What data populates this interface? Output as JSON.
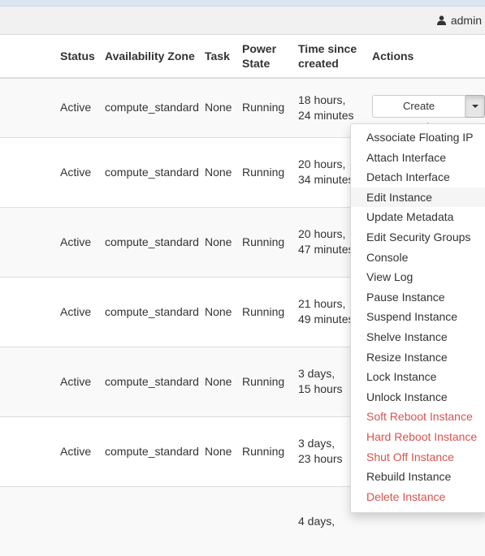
{
  "header": {
    "user_label": "admin",
    "user_icon": "user-icon"
  },
  "table": {
    "columns": [
      "Status",
      "Availability Zone",
      "Task",
      "Power State",
      "Time since created",
      "Actions"
    ],
    "rows": [
      {
        "status": "Active",
        "zone": "compute_standard",
        "task": "None",
        "power": "Running",
        "time_line1": "18 hours,",
        "time_line2": "24 minutes"
      },
      {
        "status": "Active",
        "zone": "compute_standard",
        "task": "None",
        "power": "Running",
        "time_line1": "20 hours,",
        "time_line2": "34 minutes"
      },
      {
        "status": "Active",
        "zone": "compute_standard",
        "task": "None",
        "power": "Running",
        "time_line1": "20 hours,",
        "time_line2": "47 minutes"
      },
      {
        "status": "Active",
        "zone": "compute_standard",
        "task": "None",
        "power": "Running",
        "time_line1": "21 hours,",
        "time_line2": "49 minutes"
      },
      {
        "status": "Active",
        "zone": "compute_standard",
        "task": "None",
        "power": "Running",
        "time_line1": "3 days,",
        "time_line2": "15 hours"
      },
      {
        "status": "Active",
        "zone": "compute_standard",
        "task": "None",
        "power": "Running",
        "time_line1": "3 days,",
        "time_line2": "23 hours"
      },
      {
        "time_line1": "4 days,"
      }
    ]
  },
  "actions": {
    "primary_label": "Create Snapshot",
    "menu": [
      {
        "label": "Associate Floating IP"
      },
      {
        "label": "Attach Interface"
      },
      {
        "label": "Detach Interface"
      },
      {
        "label": "Edit Instance"
      },
      {
        "label": "Update Metadata"
      },
      {
        "label": "Edit Security Groups"
      },
      {
        "label": "Console"
      },
      {
        "label": "View Log"
      },
      {
        "label": "Pause Instance"
      },
      {
        "label": "Suspend Instance"
      },
      {
        "label": "Shelve Instance"
      },
      {
        "label": "Resize Instance"
      },
      {
        "label": "Lock Instance"
      },
      {
        "label": "Unlock Instance"
      },
      {
        "label": "Soft Reboot Instance"
      },
      {
        "label": "Hard Reboot Instance"
      },
      {
        "label": "Shut Off Instance"
      },
      {
        "label": "Rebuild Instance"
      },
      {
        "label": "Delete Instance"
      }
    ]
  },
  "colors": {
    "danger": "#d9534f",
    "text": "#333333",
    "topbar": "#f1f1f1"
  }
}
